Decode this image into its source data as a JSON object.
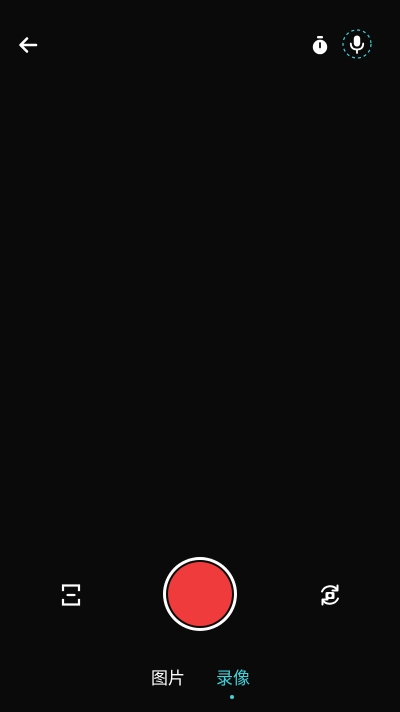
{
  "colors": {
    "background": "#0a0a0b",
    "icon": "#ffffff",
    "record_button": "#ef3b3b",
    "accent": "#3fd0d8"
  },
  "top_bar": {
    "back_icon": "arrow-left-icon",
    "timer_icon": "timer-icon",
    "mic_icon": "microphone-icon"
  },
  "bottom_controls": {
    "aspect_icon": "aspect-ratio-icon",
    "record_button": "record-button",
    "flip_icon": "flip-camera-icon"
  },
  "mode_tabs": [
    {
      "label": "图片",
      "active": false
    },
    {
      "label": "录像",
      "active": true
    }
  ]
}
